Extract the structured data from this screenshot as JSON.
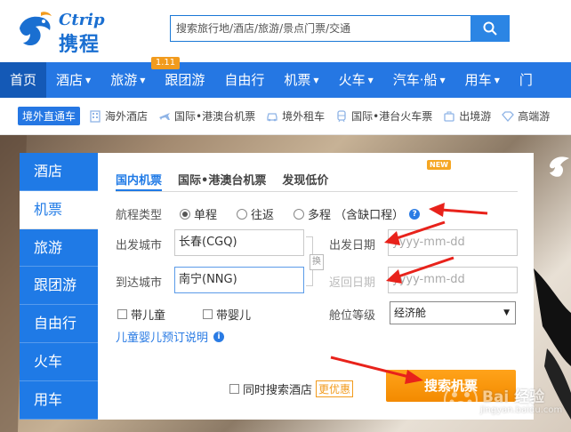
{
  "header": {
    "logo_en": "Ctrip",
    "logo_cn": "携程",
    "search_placeholder": "搜索旅行地/酒店/旅游/景点门票/交通"
  },
  "nav": {
    "items": [
      {
        "label": "首页",
        "caret": ""
      },
      {
        "label": "酒店",
        "caret": "▼"
      },
      {
        "label": "旅游",
        "caret": "▼"
      },
      {
        "label": "跟团游",
        "caret": ""
      },
      {
        "label": "自由行",
        "caret": ""
      },
      {
        "label": "机票",
        "caret": "▼"
      },
      {
        "label": "火车",
        "caret": "▼"
      },
      {
        "label": "汽车·船",
        "caret": "▼"
      },
      {
        "label": "用车",
        "caret": "▼"
      },
      {
        "label": "门",
        "caret": ""
      }
    ],
    "badge": "1.11"
  },
  "subnav": {
    "tag": "境外直通车",
    "items": [
      "海外酒店",
      "国际•港澳台机票",
      "境外租车",
      "国际•港台火车票",
      "出境游",
      "高端游"
    ]
  },
  "side_tabs": [
    "酒店",
    "机票",
    "旅游",
    "跟团游",
    "自由行",
    "火车",
    "用车"
  ],
  "form": {
    "tabs": [
      "国内机票",
      "国际•港澳台机票",
      "发现低价"
    ],
    "new_badge": "NEW",
    "trip_type_label": "航程类型",
    "trip_types": [
      "单程",
      "往返",
      "多程 （含缺口程）"
    ],
    "from_label": "出发城市",
    "from_value": "长春(CGQ)",
    "to_label": "到达城市",
    "to_value": "南宁(NNG)",
    "swap": "换",
    "depart_label": "出发日期",
    "return_label": "返回日期",
    "date_placeholder": "yyyy-mm-dd",
    "child": "带儿童",
    "infant": "带婴儿",
    "cabin_label": "舱位等级",
    "cabin_value": "经济舱",
    "child_info": "儿童婴儿预订说明",
    "hotel_check": "同时搜索酒店",
    "promo": "更优惠",
    "search_button": "搜索机票"
  },
  "watermark": {
    "text": "Bai 经验",
    "url": "jingyan.baidu.com"
  }
}
